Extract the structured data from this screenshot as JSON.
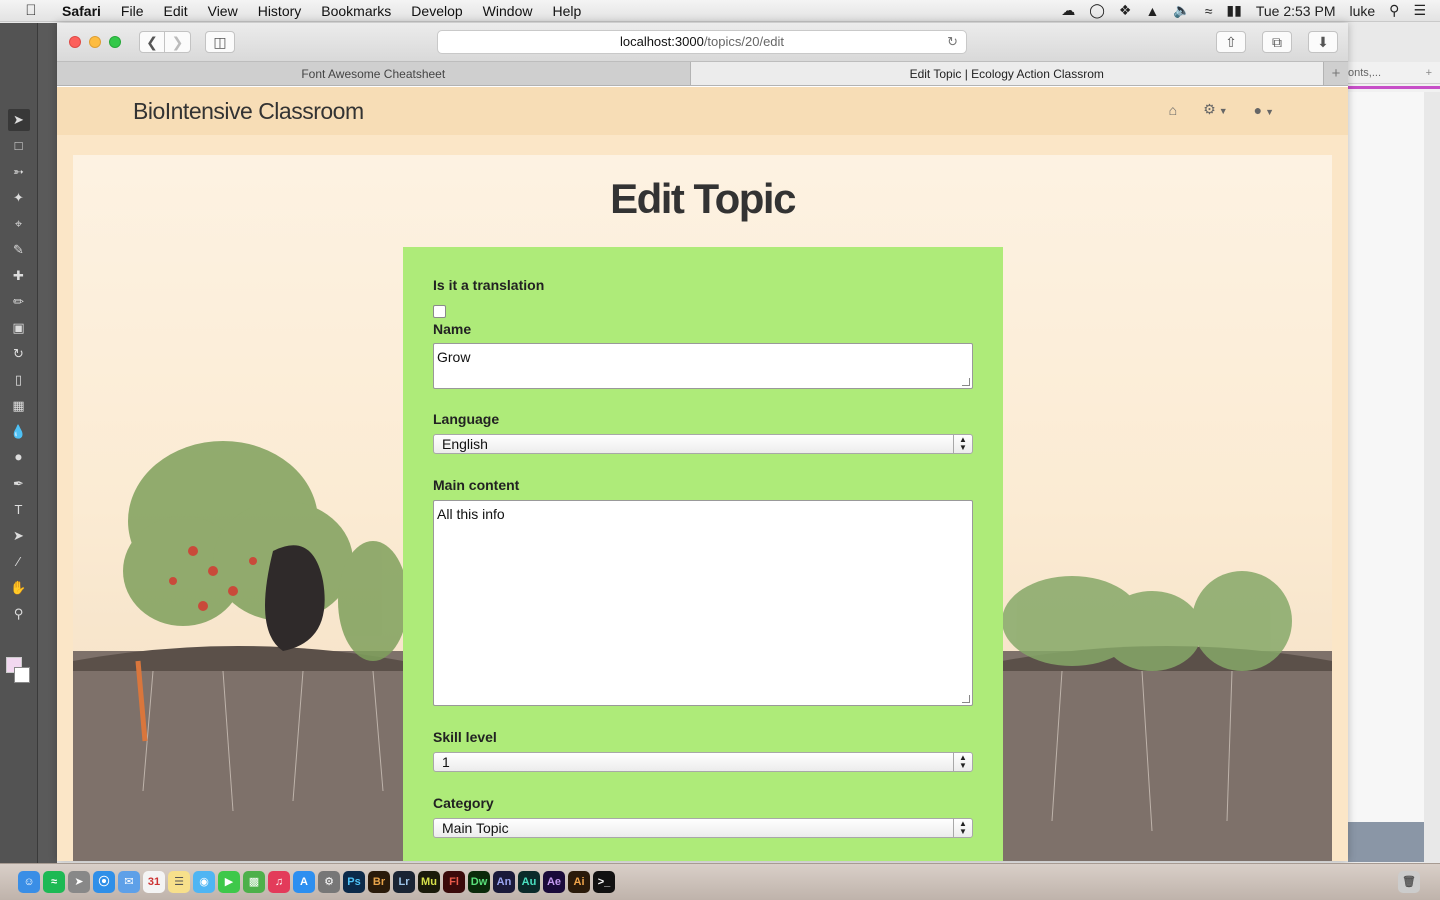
{
  "menubar": {
    "app_name": "Safari",
    "items": [
      "File",
      "Edit",
      "View",
      "History",
      "Bookmarks",
      "Develop",
      "Window",
      "Help"
    ],
    "clock": "Tue 2:53 PM",
    "user": "luke"
  },
  "browser": {
    "url_host": "localhost:3000",
    "url_path": "/topics/20/edit",
    "tabs": [
      {
        "label": "Font Awesome Cheatsheet",
        "active": false
      },
      {
        "label": "Edit Topic | Ecology Action Classrom",
        "active": true
      }
    ],
    "background_tab": "onts,..."
  },
  "site": {
    "brand": "BioIntensive Classroom"
  },
  "page": {
    "title": "Edit Topic"
  },
  "form": {
    "translation_label": "Is it a translation",
    "translation_checked": false,
    "name_label": "Name",
    "name_value": "Grow",
    "language_label": "Language",
    "language_value": "English",
    "main_content_label": "Main content",
    "main_content_value": "All this info",
    "skill_label": "Skill level",
    "skill_value": "1",
    "category_label": "Category",
    "category_value": "Main Topic"
  },
  "colors": {
    "navbar_bg": "#f7ddb6",
    "form_bg": "#aeeb79",
    "page_bg": "#fbe6c7"
  }
}
